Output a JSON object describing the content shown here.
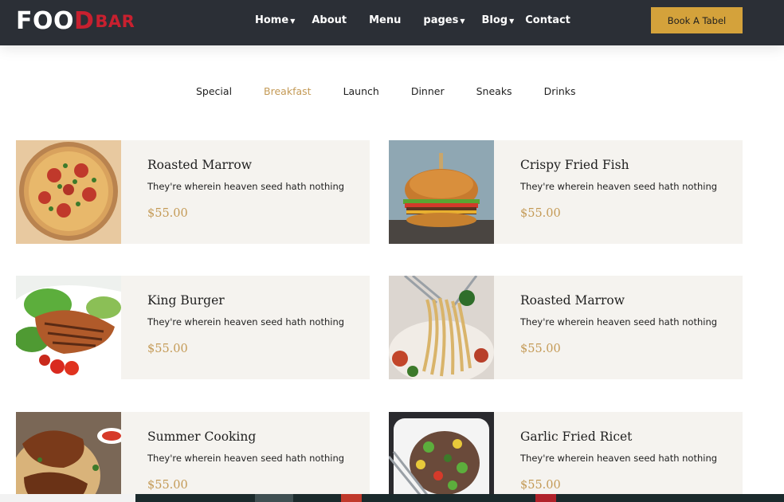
{
  "header": {
    "logo": {
      "part1": "FOO",
      "part2": "D",
      "part3": "BAR"
    },
    "nav": [
      {
        "label": "Home",
        "dropdown": true
      },
      {
        "label": "About",
        "dropdown": false
      },
      {
        "label": "Menu",
        "dropdown": false
      },
      {
        "label": "pages",
        "dropdown": true
      },
      {
        "label": "Blog",
        "dropdown": true
      },
      {
        "label": "Contact",
        "dropdown": false
      }
    ],
    "cta_label": "Book A Tabel"
  },
  "tabs": {
    "items": [
      "Special",
      "Breakfast",
      "Launch",
      "Dinner",
      "Sneaks",
      "Drinks"
    ],
    "active": "Breakfast"
  },
  "menu_items": [
    {
      "title": "Roasted Marrow",
      "description": "They're wherein heaven seed hath nothing",
      "price": "$55.00",
      "image": "pizza"
    },
    {
      "title": "Crispy Fried Fish",
      "description": "They're wherein heaven seed hath nothing",
      "price": "$55.00",
      "image": "burger"
    },
    {
      "title": "King Burger",
      "description": "They're wherein heaven seed hath nothing",
      "price": "$55.00",
      "image": "grilled-salmon"
    },
    {
      "title": "Roasted Marrow",
      "description": "They're wherein heaven seed hath nothing",
      "price": "$55.00",
      "image": "pasta"
    },
    {
      "title": "Summer Cooking",
      "description": "They're wherein heaven seed hath nothing",
      "price": "$55.00",
      "image": "roast-chicken"
    },
    {
      "title": "Garlic Fried Ricet",
      "description": "They're wherein heaven seed hath nothing",
      "price": "$55.00",
      "image": "salad"
    }
  ],
  "colors": {
    "header_bg": "#2b2f36",
    "accent": "#d4a23b",
    "price": "#c49a56",
    "logo_red": "#c8202f",
    "card_bg": "#f5f3ef"
  }
}
